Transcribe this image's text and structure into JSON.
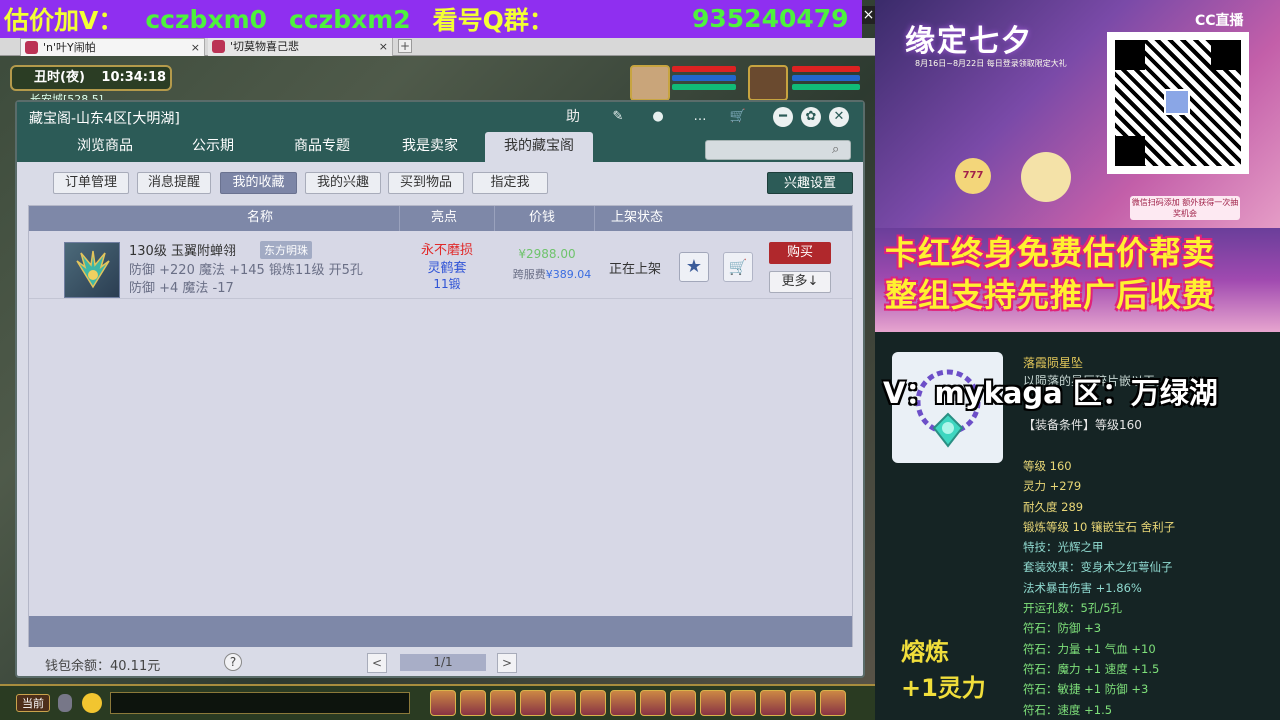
{
  "banner": {
    "part1": "估价加V：",
    "part2": "cczbxm0",
    "part3": "cczbxm2",
    "part4": "看号Q群：",
    "part5": "935240479",
    "close": "×"
  },
  "browser": {
    "tabs": [
      {
        "label": "'n'叶Y闹帕",
        "close": "×"
      },
      {
        "label": "'切莫物喜己悲",
        "close": "×"
      }
    ],
    "add": "+"
  },
  "game": {
    "time_label": "丑时(夜)",
    "time": "10:34:18",
    "location": "长安城[528,5]"
  },
  "window": {
    "title": "藏宝阁-山东4区[大明湖]",
    "icons": {
      "help": "助",
      "pencil": "✎",
      "record": "●",
      "chat": "…",
      "cart": "🛒"
    },
    "controls": {
      "minimize": "━",
      "settings": "✿",
      "close": "✕"
    },
    "tabs": [
      "浏览商品",
      "公示期",
      "商品专题",
      "我是卖家",
      "我的藏宝阁"
    ],
    "search": {
      "placeholder": "",
      "icon": "⌕"
    },
    "subtabs": [
      "订单管理",
      "消息提醒",
      "我的收藏",
      "我的兴趣",
      "买到物品",
      "指定我"
    ],
    "interest_settings": "兴趣设置",
    "columns": [
      "名称",
      "亮点",
      "价钱",
      "上架状态"
    ],
    "row": {
      "name": "130级 玉翼附蝉翎",
      "tag": "东方明珠",
      "attr1": "防御 +220 魔法 +145 锻炼11级 开5孔",
      "attr2": "防御 +4 魔法 -17",
      "highlights": [
        "永不磨损",
        "灵鹤套",
        "11锻"
      ],
      "price": "¥2988.00",
      "fee_label": "跨服费",
      "fee": "¥389.04",
      "status": "正在上架",
      "star": "★",
      "cart": "🛒",
      "buy": "购买",
      "more": "更多↓"
    },
    "wallet": "钱包余额：40.11元",
    "help": "?",
    "page_prev": "<",
    "page": "1/1",
    "page_next": ">"
  },
  "chat": {
    "now": "当前"
  },
  "promo": {
    "title": "缘定七夕",
    "subtitle": "8月16日~8月22日 每日登录领取限定大礼",
    "cc": "CC直播",
    "badge": "777",
    "event": "微信扫码添加 额外获得一次抽奖机会",
    "band1": "卡红终身免费估价帮卖",
    "band2": "整组支持先推广后收费"
  },
  "detail": {
    "name": "落霞陨星坠",
    "desc": "以陨落的星辰碎片嵌以玉，",
    "req": "【装备条件】等级160",
    "overlay": "V：mykaga  区：万绿湖",
    "stats": [
      {
        "text": "等级 160",
        "tone": "yellow"
      },
      {
        "text": "灵力 +279",
        "tone": "yellow"
      },
      {
        "text": "耐久度 289",
        "tone": "yellow"
      },
      {
        "text": "锻炼等级 10 镶嵌宝石 舍利子",
        "tone": "yellow"
      },
      {
        "text": "特技：光辉之甲",
        "tone": "cyan"
      },
      {
        "text": "套装效果：变身术之红萼仙子",
        "tone": "cyan"
      },
      {
        "text": "法术暴击伤害 +1.86%",
        "tone": "cyan"
      },
      {
        "text": "开运孔数：5孔/5孔",
        "tone": "green"
      },
      {
        "text": "符石：防御 +3",
        "tone": "green"
      },
      {
        "text": "符石：力量 +1 气血 +10",
        "tone": "green"
      },
      {
        "text": "符石：魔力 +1 速度 +1.5",
        "tone": "green"
      },
      {
        "text": "符石：敏捷 +1 防御 +3",
        "tone": "green"
      },
      {
        "text": "符石：速度 +1.5",
        "tone": "green"
      }
    ],
    "refine1": "熔炼",
    "refine2": "+1灵力"
  },
  "colors": {
    "banner_bg": "#8f2ff0",
    "window_title_bg": "#2c5b57",
    "buy_red": "#b0282c",
    "list_header": "#7e88a8"
  }
}
